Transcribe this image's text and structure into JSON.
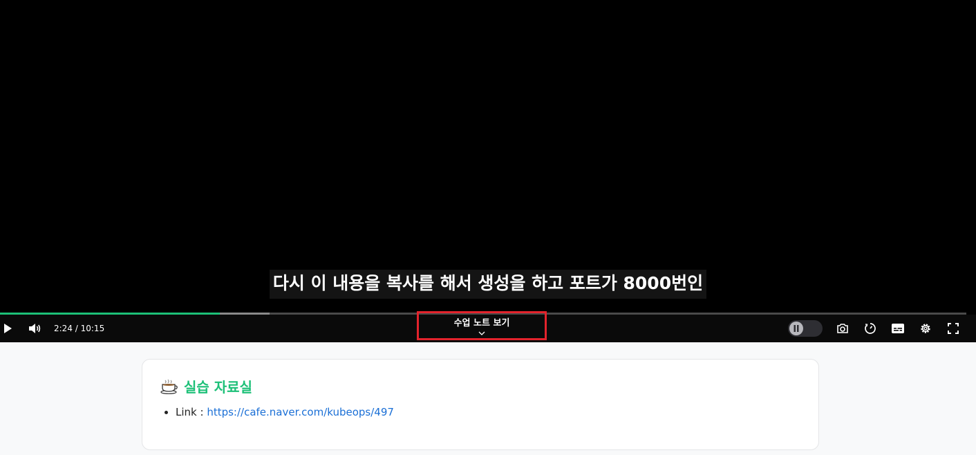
{
  "player": {
    "subtitle": "다시 이 내용을 복사를 해서 생성을 하고 포트가 8000번인",
    "time_display": "2:24 / 10:15",
    "progress_played_fraction": 0.2274,
    "progress_buffered_fraction": 0.279,
    "accent_color": "#1dc078",
    "note_button_label": "수업 노트 보기",
    "icons": {
      "play": "play-icon",
      "volume": "volume-icon",
      "chevron": "chevron-down-icon",
      "toggle": "pause-icon",
      "screenshot": "camera-icon",
      "speed": "playback-speed-icon",
      "subtitles": "subtitles-icon",
      "settings": "gear-icon",
      "fullscreen": "fullscreen-icon"
    }
  },
  "notes": {
    "title": "실습 자료실",
    "emoji": "coffee-icon",
    "items": [
      {
        "label": "Link : ",
        "link": "https://cafe.naver.com/kubeops/497"
      }
    ]
  }
}
